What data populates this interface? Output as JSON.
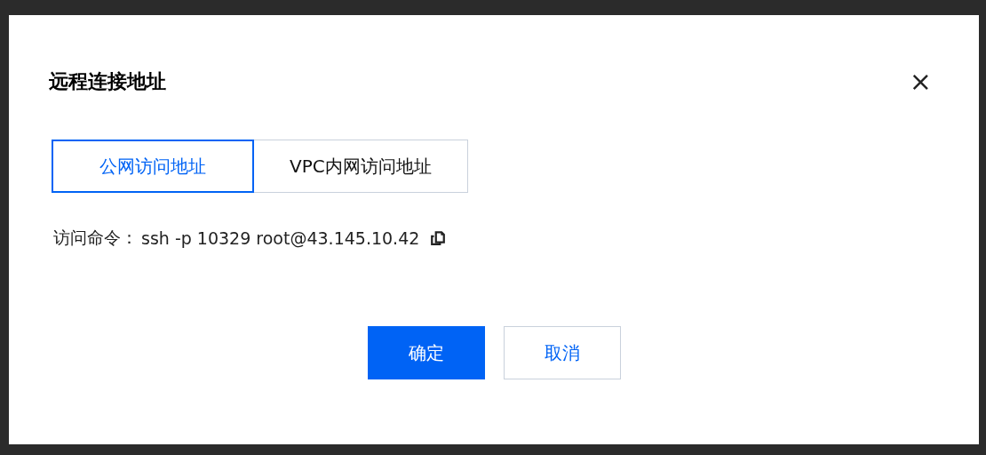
{
  "dialog": {
    "title": "远程连接地址",
    "close": "×"
  },
  "tabs": [
    {
      "label": "公网访问地址",
      "selected": true
    },
    {
      "label": "VPC内网访问地址",
      "selected": false
    }
  ],
  "command": {
    "label": "访问命令：",
    "value": "ssh -p 10329 root@43.145.10.42"
  },
  "buttons": [
    {
      "label": "确定",
      "kind": "primary"
    },
    {
      "label": "取消",
      "kind": "secondary"
    }
  ]
}
